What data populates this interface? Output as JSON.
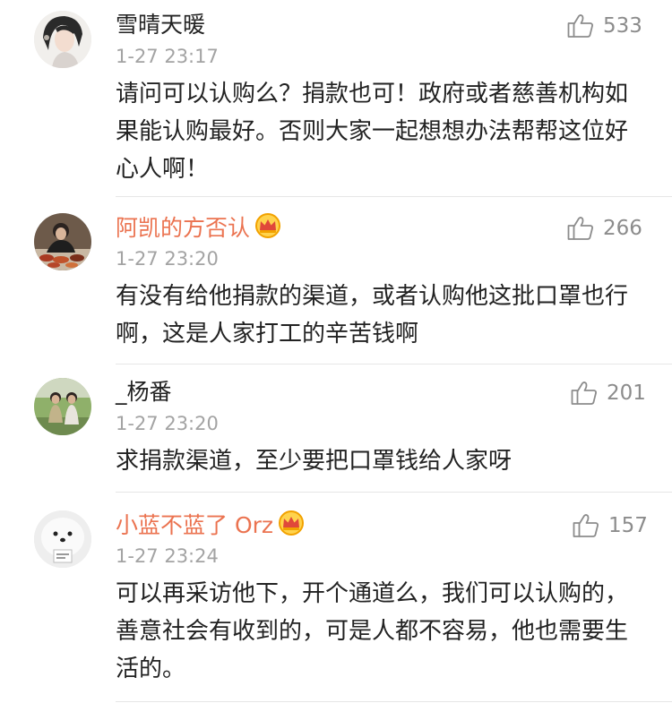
{
  "comments": [
    {
      "username": "雪晴天暖",
      "time": "1-27 23:17",
      "likes": "533",
      "content": "请问可以认购么？捐款也可！政府或者慈善机构如果能认购最好。否则大家一起想想办法帮帮这位好心人啊！",
      "vip": false
    },
    {
      "username": "阿凯的方否认",
      "time": "1-27 23:20",
      "likes": "266",
      "content": "有没有给他捐款的渠道，或者认购他这批口罩也行啊，这是人家打工的辛苦钱啊",
      "vip": true
    },
    {
      "username": "_杨番",
      "time": "1-27 23:20",
      "likes": "201",
      "content": "求捐款渠道，至少要把口罩钱给人家呀",
      "vip": false
    },
    {
      "username": "小蓝不蓝了 Orz",
      "time": "1-27 23:24",
      "likes": "157",
      "content": "可以再采访他下，开个通道么，我们可以认购的，善意社会有收到的，可是人都不容易，他也需要生活的。",
      "vip": true
    }
  ],
  "colors": {
    "vip_name": "#eb7350",
    "normal_name": "#222222",
    "timestamp": "#a3a3a3",
    "divider": "#e6e6e6",
    "crown": "#f2a200"
  },
  "icons": {
    "like": "thumbs-up-icon",
    "vip_badge": "crown-icon"
  }
}
